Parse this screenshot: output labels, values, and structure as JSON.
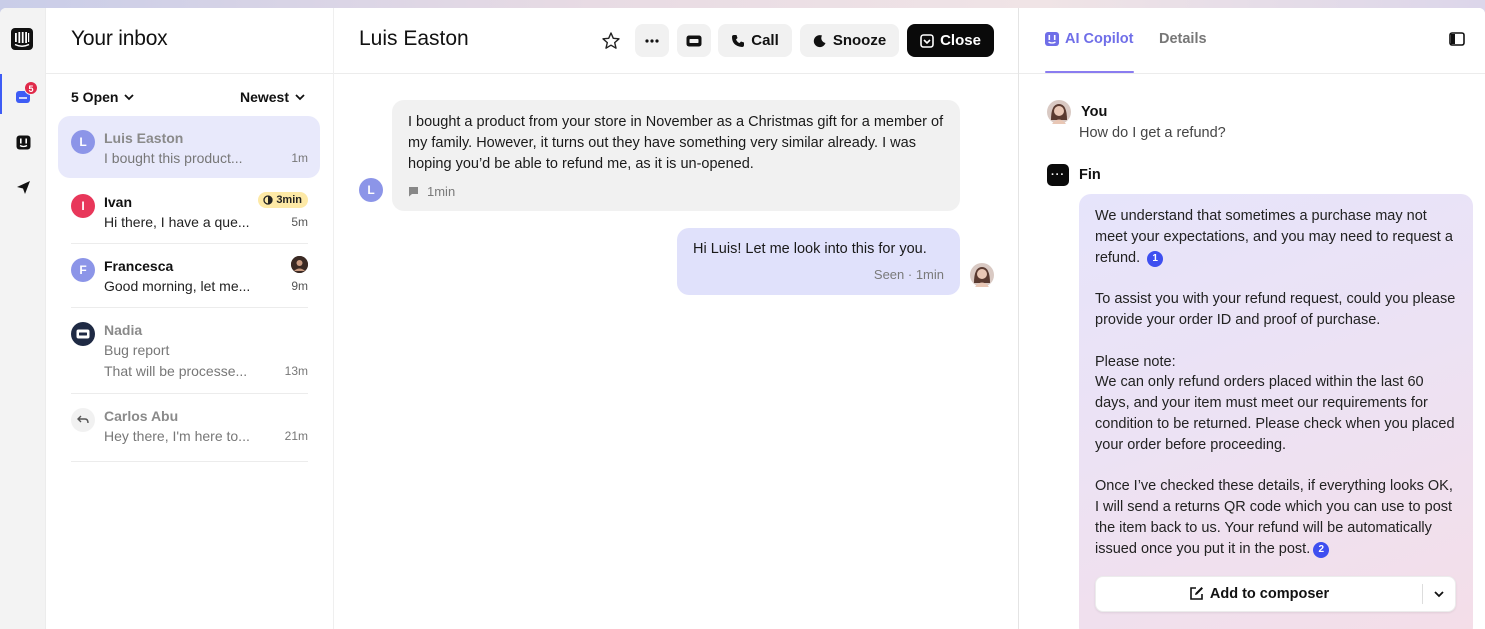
{
  "rail": {
    "badge_count": "5"
  },
  "inbox": {
    "title": "Your inbox",
    "filter_status": "5 Open",
    "sort": "Newest",
    "conversations": [
      {
        "initial": "L",
        "name": "Luis Easton",
        "preview": "I bought this product...",
        "time": "1m",
        "avatar_color": "#8c95e8"
      },
      {
        "initial": "I",
        "name": "Ivan",
        "preview": "Hi there, I have a que...",
        "time": "5m",
        "sla": "3min",
        "avatar_color": "#e8375a"
      },
      {
        "initial": "F",
        "name": "Francesca",
        "preview": "Good morning, let me...",
        "time": "9m",
        "avatar_color": "#8c95e8"
      },
      {
        "name": "Nadia",
        "subject": "Bug report",
        "preview": "That will be processe...",
        "time": "13m",
        "avatar_color": "#1f2a44"
      },
      {
        "name": "Carlos Abu",
        "preview": "Hey there, I'm here to...",
        "time": "21m"
      }
    ]
  },
  "conversation": {
    "title": "Luis Easton",
    "buttons": {
      "call": "Call",
      "snooze": "Snooze",
      "close": "Close"
    },
    "messages": [
      {
        "initial": "L",
        "text": "I bought a product from your store in November as a Christmas gift for a member of my family. However, it turns out they have something very similar already. I was hoping you’d be able to refund me, as it is un-opened.",
        "meta": "1min"
      },
      {
        "text": "Hi Luis! Let me look into this for you.",
        "meta": "Seen · 1min"
      }
    ]
  },
  "copilot": {
    "tabs": [
      "AI Copilot",
      "Details"
    ],
    "you_label": "You",
    "you_question": "How do I get a refund?",
    "fin_label": "Fin",
    "answer": {
      "p1": "We understand that sometimes a purchase may not meet your expectations, and you may need to request a refund.",
      "p1_cite": "1",
      "p2": "To assist you with your refund request, could you please provide your order ID and proof of purchase.",
      "p3_heading": "Please note:",
      "p3": "We can only refund orders placed within the last 60 days, and your item must meet our requirements for condition to be returned. Please check when you placed your order before proceeding.",
      "p4": "Once I’ve checked these details, if everything looks OK, I will send a returns QR code which you can use to post the item back to us. Your refund will be automatically issued once you put it in the post.",
      "p4_cite": "2"
    },
    "add_to_composer": "Add to composer"
  }
}
